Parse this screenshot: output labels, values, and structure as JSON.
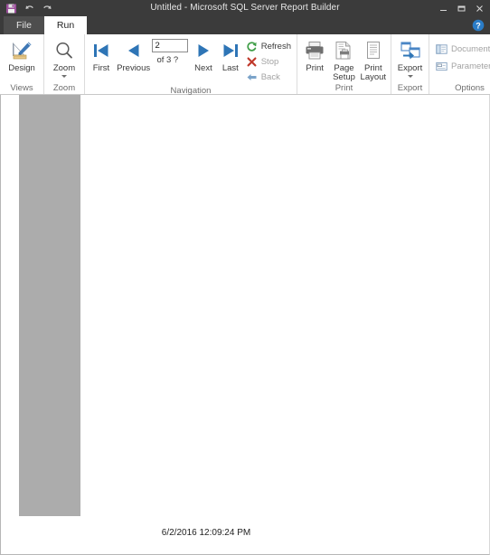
{
  "window": {
    "title": "Untitled - Microsoft SQL Server Report Builder",
    "quick_access": [
      {
        "name": "save-icon",
        "label": "Save"
      },
      {
        "name": "undo-icon",
        "label": "Undo"
      },
      {
        "name": "redo-icon",
        "label": "Redo"
      }
    ],
    "controls": [
      {
        "name": "minimize-button",
        "label": "Minimize"
      },
      {
        "name": "restore-button",
        "label": "Restore Down"
      },
      {
        "name": "close-button",
        "label": "Close"
      }
    ],
    "help_label": "Help"
  },
  "tabs": [
    {
      "label": "File",
      "active": false
    },
    {
      "label": "Run",
      "active": true
    }
  ],
  "ribbon": {
    "groups": [
      {
        "label": "Views",
        "items": [
          {
            "label": "Design",
            "icon": "design-icon"
          }
        ]
      },
      {
        "label": "Zoom",
        "items": [
          {
            "label": "Zoom",
            "icon": "zoom-icon",
            "has_dropdown": true
          }
        ]
      },
      {
        "label": "Navigation",
        "items": [
          {
            "label": "First",
            "icon": "first-page-icon"
          },
          {
            "label": "Previous",
            "icon": "previous-page-icon"
          },
          {
            "label": "Next",
            "icon": "next-page-icon"
          },
          {
            "label": "Last",
            "icon": "last-page-icon"
          },
          {
            "label": "Refresh",
            "icon": "refresh-icon"
          },
          {
            "label": "Stop",
            "icon": "stop-icon"
          },
          {
            "label": "Back",
            "icon": "back-icon"
          }
        ],
        "page_number": {
          "value": "2",
          "placeholder": "",
          "of_label": "of  3 ?"
        }
      },
      {
        "label": "Print",
        "items": [
          {
            "label": "Print",
            "icon": "print-icon"
          },
          {
            "label": "Page",
            "label2": "Setup",
            "icon": "page-setup-icon"
          },
          {
            "label": "Print",
            "label2": "Layout",
            "icon": "print-layout-icon"
          }
        ]
      },
      {
        "label": "Export",
        "items": [
          {
            "label": "Export",
            "icon": "export-icon",
            "has_dropdown": true
          }
        ]
      },
      {
        "label": "Options",
        "items": [
          {
            "label": "Document",
            "icon": "document-map-icon"
          },
          {
            "label": "Parameters",
            "icon": "parameters-icon",
            "has_more": true
          }
        ]
      }
    ]
  },
  "document": {
    "footer_timestamp": "6/2/2016 12:09:24 PM"
  }
}
